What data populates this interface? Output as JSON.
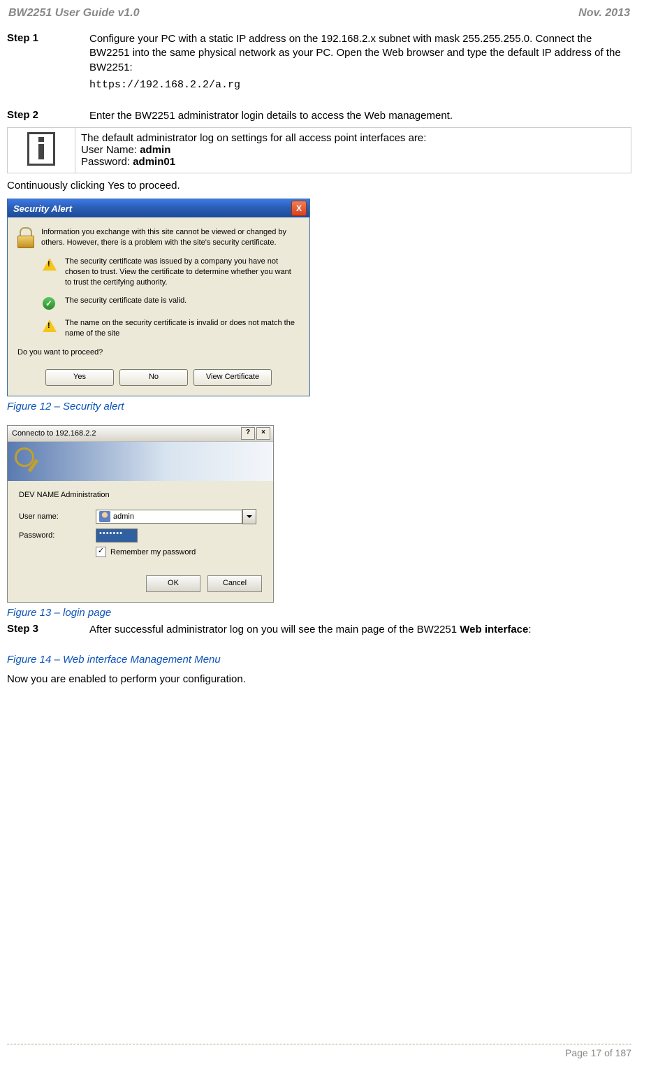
{
  "header": {
    "left": "BW2251 User Guide v1.0",
    "right": "Nov.  2013"
  },
  "step1": {
    "label": "Step 1",
    "text": "Configure your PC with a static IP address on the 192.168.2.x subnet with mask 255.255.255.0. Connect the BW2251 into the same physical network as your PC. Open the Web browser and type the default IP address of the BW2251:",
    "code": "https://192.168.2.2/a.rg"
  },
  "step2": {
    "label": "Step 2",
    "text": "Enter the BW2251 administrator login details to access the Web management."
  },
  "note": {
    "line1": "The default administrator log on settings for all access point interfaces are:",
    "user_label": "User Name: ",
    "user_value": "admin",
    "pass_label": "Password:   ",
    "pass_value": "admin01"
  },
  "proceed_text": "Continuously clicking Yes to proceed.",
  "security_dialog": {
    "title": "Security Alert",
    "close": "X",
    "msg1": "Information you exchange with this site cannot be viewed or changed by others. However, there is a problem with the site's security certificate.",
    "msg2": "The security certificate was issued by a company you have not chosen to trust. View the certificate to determine whether you want to trust the certifying authority.",
    "msg3": "The security certificate date is valid.",
    "msg4": "The name on the security certificate is invalid or does not match the name of the site",
    "prompt": "Do you want to proceed?",
    "btn_yes": "Yes",
    "btn_no": "No",
    "btn_view": "View Certificate"
  },
  "fig12": "Figure 12 – Security alert",
  "login_dialog": {
    "title": "Connecto to 192.168.2.2",
    "help": "?",
    "close": "×",
    "heading": "DEV NAME Administration",
    "user_label": "User name:",
    "user_value": "admin",
    "pass_label": "Password:",
    "pass_value": "•••••••",
    "remember": "Remember my password",
    "checkmark": "✓",
    "btn_ok": "OK",
    "btn_cancel": "Cancel"
  },
  "fig13": "Figure 13 – login page",
  "step3": {
    "label": "Step 3",
    "text_pre": "After successful administrator log on you will see the main page of the BW2251 ",
    "text_bold": "Web interface",
    "text_post": ":"
  },
  "fig14": "Figure 14 – Web interface  Management Menu",
  "closing": "Now you are enabled to perform your configuration.",
  "footer": {
    "page": "Page 17 of 187"
  }
}
